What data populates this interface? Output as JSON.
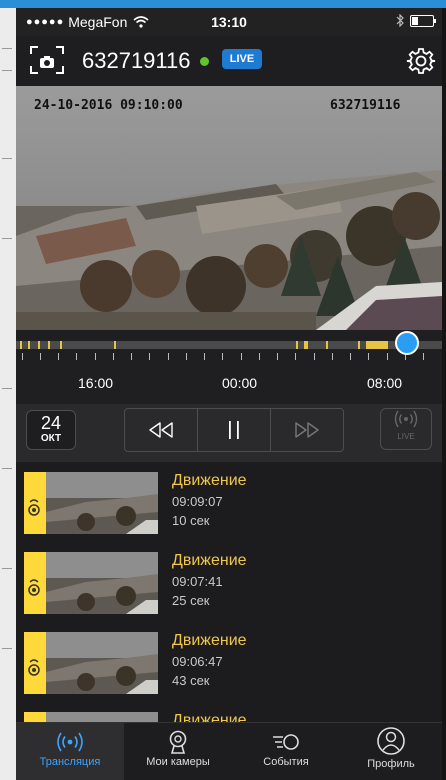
{
  "status_bar": {
    "carrier": "MegaFon",
    "time": "13:10"
  },
  "header": {
    "camera_id": "632719116",
    "live_badge": "LIVE",
    "online_color": "#5ec531"
  },
  "video": {
    "timestamp_overlay": "24-10-2016 09:10:00",
    "camera_overlay": "632719116"
  },
  "timeline": {
    "labels": [
      "16:00",
      "00:00",
      "08:00"
    ],
    "accent_color": "#e7c542",
    "handle_color": "#2b9df2"
  },
  "controls": {
    "date_day": "24",
    "date_month": "ОКТ",
    "live_label": "LIVE"
  },
  "events": [
    {
      "title": "Движение",
      "time": "09:09:07",
      "duration": "10 сек"
    },
    {
      "title": "Движение",
      "time": "09:07:41",
      "duration": "25 сек"
    },
    {
      "title": "Движение",
      "time": "09:06:47",
      "duration": "43 сек"
    },
    {
      "title": "Движение"
    }
  ],
  "tabs": [
    {
      "label": "Трансляция",
      "icon": "broadcast-icon",
      "active": true
    },
    {
      "label": "Мои камеры",
      "icon": "webcam-icon",
      "active": false
    },
    {
      "label": "События",
      "icon": "events-icon",
      "active": false
    },
    {
      "label": "Профиль",
      "icon": "profile-icon",
      "active": false
    }
  ]
}
